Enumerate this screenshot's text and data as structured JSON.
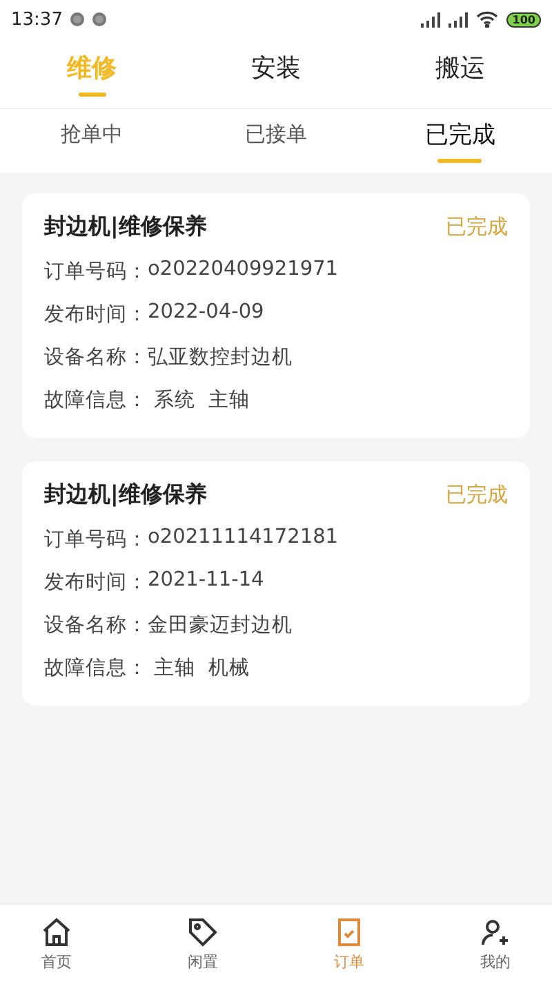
{
  "status_bar": {
    "time": "13:37",
    "battery": "100"
  },
  "tabs": [
    {
      "label": "维修",
      "selected": true
    },
    {
      "label": "安装",
      "selected": false
    },
    {
      "label": "搬运",
      "selected": false
    }
  ],
  "sub_tabs": [
    {
      "label": "抢单中",
      "selected": false
    },
    {
      "label": "已接单",
      "selected": false
    },
    {
      "label": "已完成",
      "selected": true
    }
  ],
  "orders": [
    {
      "title": "封边机|维修保养",
      "status": "已完成",
      "fields": [
        {
          "label": "订单号码：",
          "value": "o20220409921971"
        },
        {
          "label": "发布时间：",
          "value": "2022-04-09"
        },
        {
          "label": "设备名称：",
          "value": "弘亚数控封边机"
        },
        {
          "label": "故障信息：",
          "value": " 系统  主轴"
        }
      ]
    },
    {
      "title": "封边机|维修保养",
      "status": "已完成",
      "fields": [
        {
          "label": "订单号码：",
          "value": "o20211114172181"
        },
        {
          "label": "发布时间：",
          "value": "2021-11-14"
        },
        {
          "label": "设备名称：",
          "value": "金田豪迈封边机"
        },
        {
          "label": "故障信息：",
          "value": " 主轴  机械"
        }
      ]
    }
  ],
  "bottom_nav": [
    {
      "kind": "home",
      "label": "首页",
      "selected": false
    },
    {
      "kind": "idle",
      "label": "闲置",
      "selected": false
    },
    {
      "kind": "orders",
      "label": "订单",
      "selected": true
    },
    {
      "kind": "me",
      "label": "我的",
      "selected": false
    }
  ]
}
